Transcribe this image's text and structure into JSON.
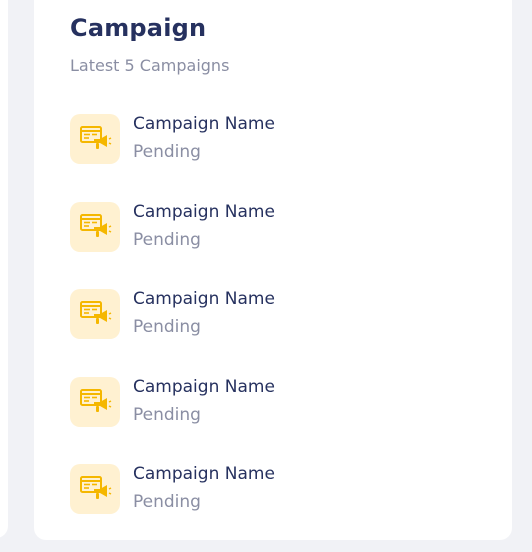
{
  "card": {
    "title": "Campaign",
    "subtitle": "Latest 5 Campaigns"
  },
  "campaigns": [
    {
      "name": "Campaign Name",
      "status": "Pending"
    },
    {
      "name": "Campaign Name",
      "status": "Pending"
    },
    {
      "name": "Campaign Name",
      "status": "Pending"
    },
    {
      "name": "Campaign Name",
      "status": "Pending"
    },
    {
      "name": "Campaign Name",
      "status": "Pending"
    }
  ],
  "icons": {
    "campaign_item": "campaign-megaphone-icon"
  },
  "colors": {
    "title": "#26315f",
    "muted_text": "#8a8ea3",
    "icon_bg": "#fff1d1",
    "icon_accent": "#f5b700",
    "page_bg": "#f1f2f6",
    "card_bg": "#ffffff"
  }
}
